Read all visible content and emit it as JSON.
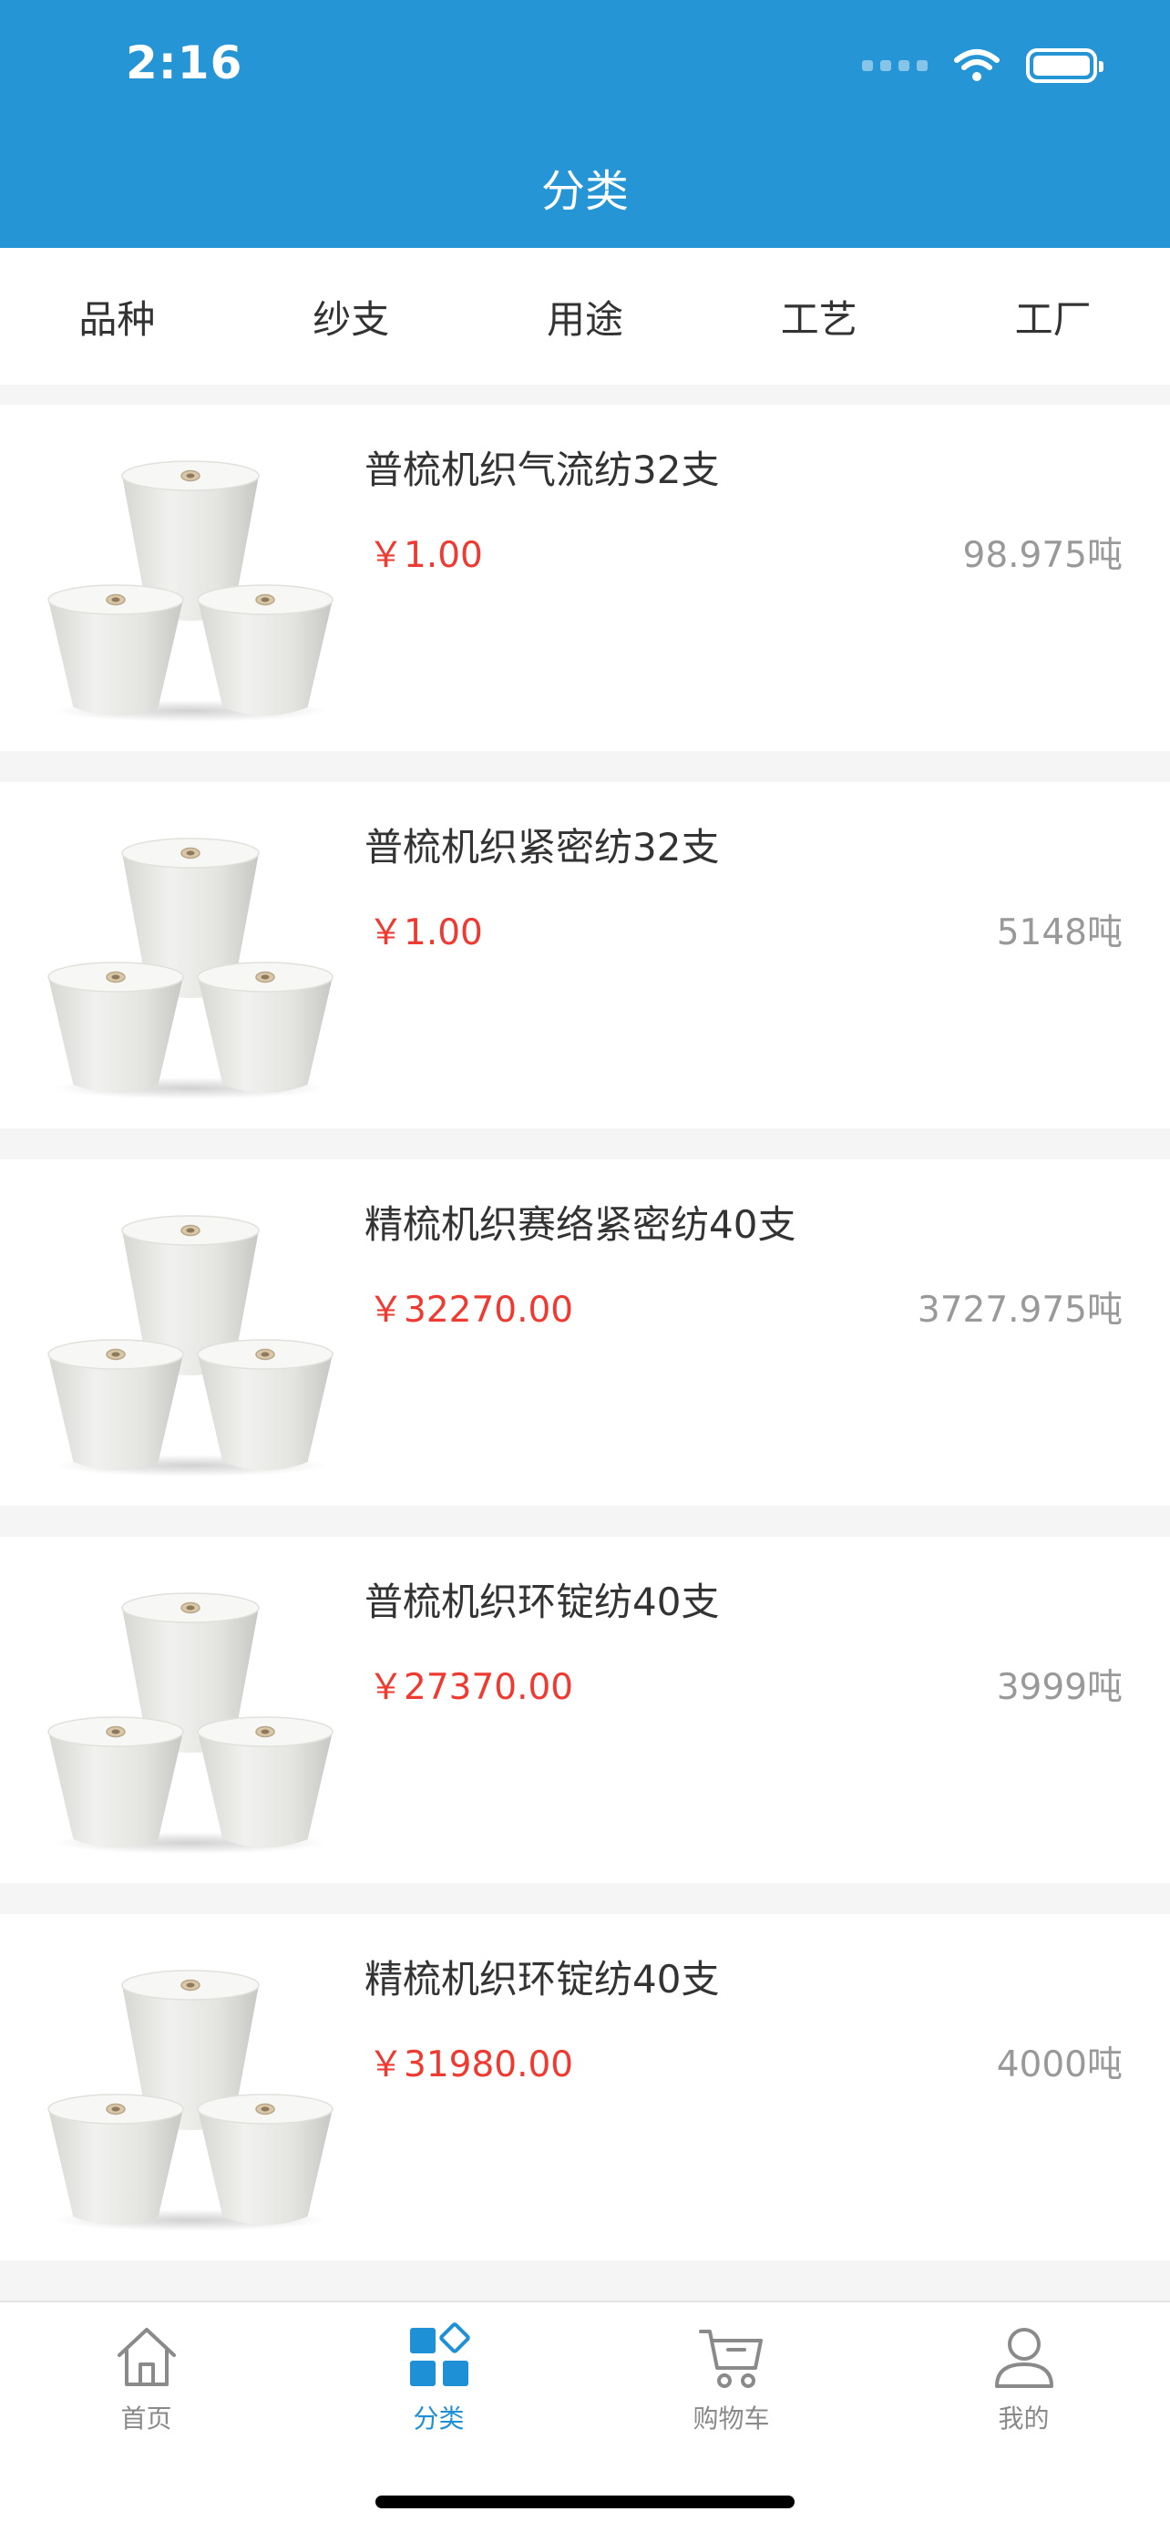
{
  "status_bar": {
    "time": "2:16"
  },
  "header": {
    "title": "分类"
  },
  "filters": [
    "品种",
    "纱支",
    "用途",
    "工艺",
    "工厂"
  ],
  "products": [
    {
      "name": "普梳机织气流纺32支",
      "price": "￥1.00",
      "stock": "98.975吨"
    },
    {
      "name": "普梳机织紧密纺32支",
      "price": "￥1.00",
      "stock": "5148吨"
    },
    {
      "name": "精梳机织赛络紧密纺40支",
      "price": "￥32270.00",
      "stock": "3727.975吨"
    },
    {
      "name": "普梳机织环锭纺40支",
      "price": "￥27370.00",
      "stock": "3999吨"
    },
    {
      "name": "精梳机织环锭纺40支",
      "price": "￥31980.00",
      "stock": "4000吨"
    }
  ],
  "tabbar": {
    "items": [
      {
        "label": "首页",
        "icon": "home-icon"
      },
      {
        "label": "分类",
        "icon": "category-icon",
        "active": true
      },
      {
        "label": "购物车",
        "icon": "cart-icon"
      },
      {
        "label": "我的",
        "icon": "user-icon"
      }
    ]
  },
  "colors": {
    "header": "#2595d6",
    "price": "#ef3a32",
    "active_tab": "#1e90d6"
  }
}
